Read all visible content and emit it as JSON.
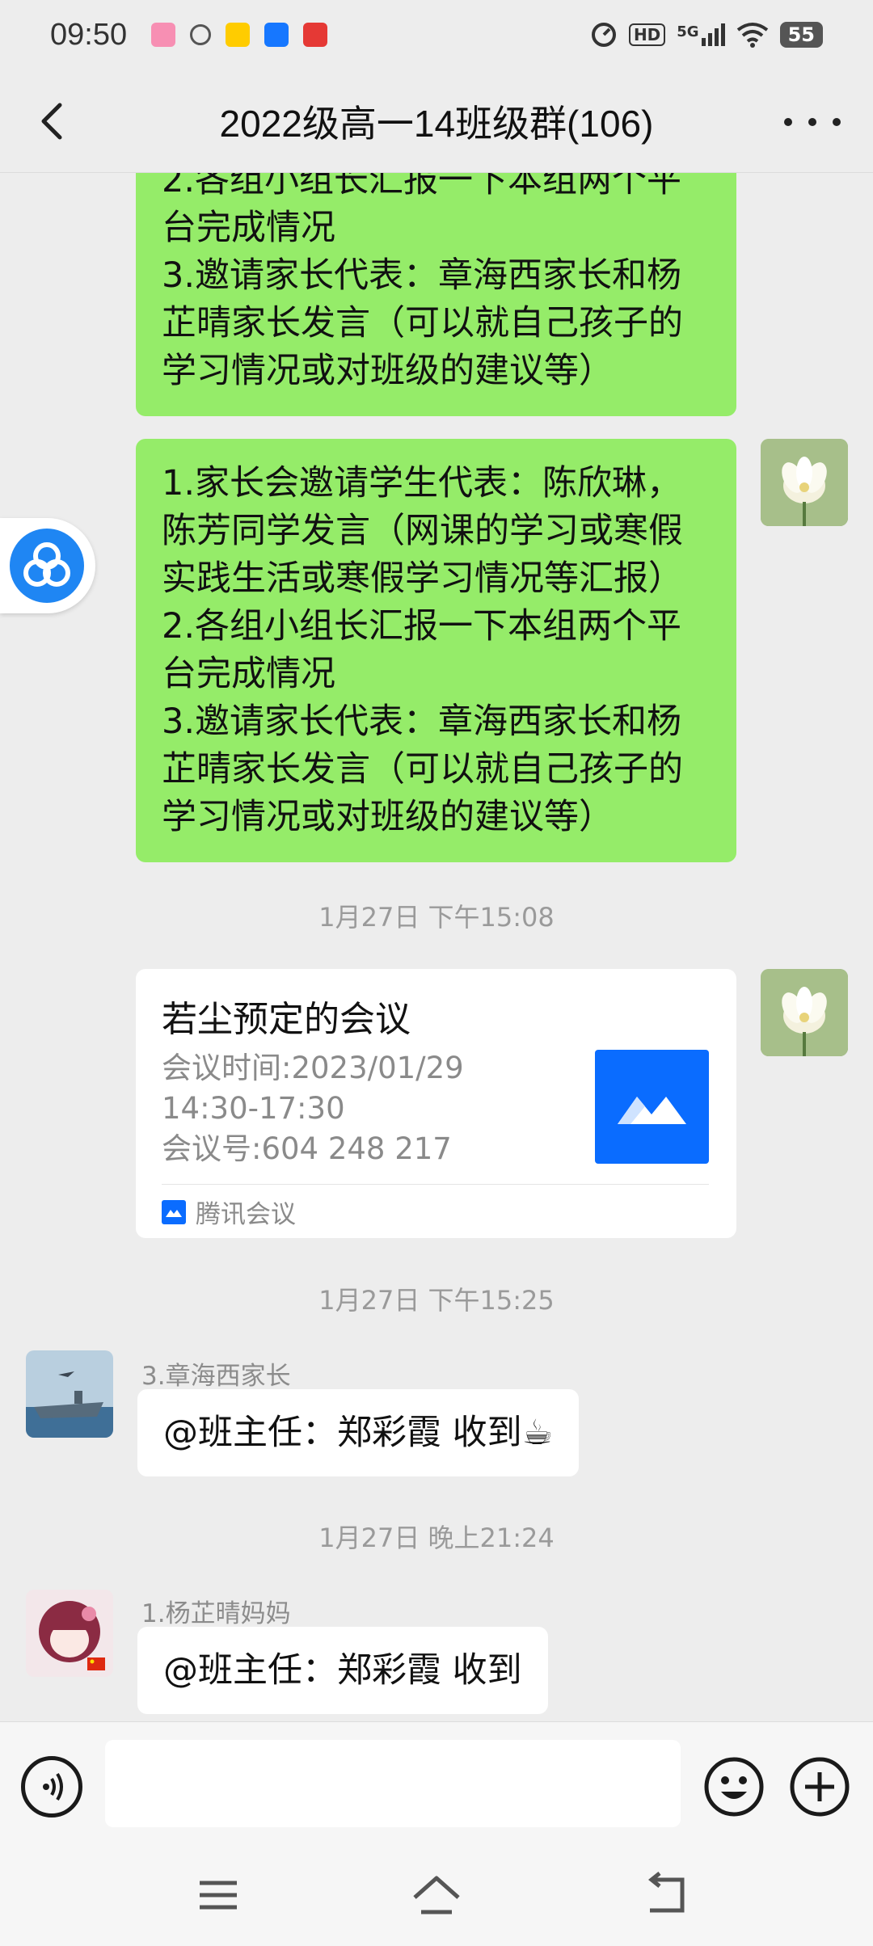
{
  "status_bar": {
    "time": "09:50",
    "network": "5G",
    "hd": "HD",
    "battery": "55"
  },
  "nav": {
    "title": "2022级高一14班级群(106)"
  },
  "messages": {
    "partial": "2.各组小组长汇报一下本组两个平\n台完成情况\n3.邀请家长代表：章海西家长和杨\n芷晴家长发言（可以就自己孩子的\n学习情况或对班级的建议等）",
    "full": "1.家长会邀请学生代表：陈欣琳，\n陈芳同学发言（网课的学习或寒假\n实践生活或寒假学习情况等汇报）\n2.各组小组长汇报一下本组两个平\n台完成情况\n3.邀请家长代表：章海西家长和杨\n芷晴家长发言（可以就自己孩子的\n学习情况或对班级的建议等）",
    "time1": "1月27日  下午15:08",
    "card": {
      "title": "若尘预定的会议",
      "line1": "会议时间:2023/01/29",
      "line2": "14:30-17:30",
      "line3": "会议号:604  248  217",
      "source": "腾讯会议"
    },
    "time2": "1月27日  下午15:25",
    "sender1": "3.章海西家长",
    "reply1": "@班主任：郑彩霞  收到☕",
    "time3": "1月27日  晚上21:24",
    "sender2": "1.杨芷晴妈妈",
    "reply2": "@班主任：郑彩霞  收到"
  },
  "input": {
    "value": ""
  }
}
